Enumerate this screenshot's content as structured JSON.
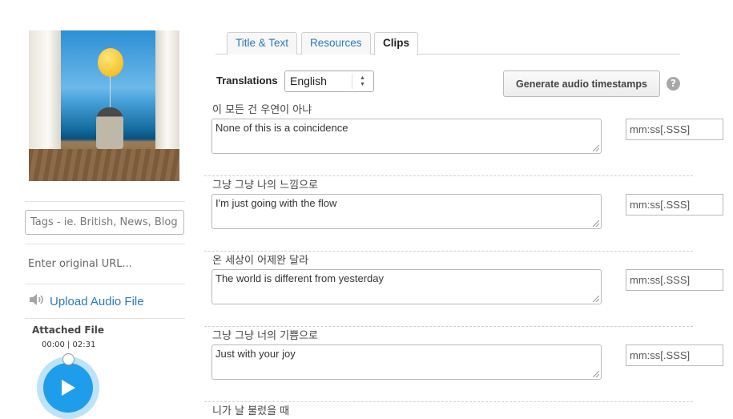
{
  "left": {
    "tags_placeholder": "Tags - ie. British, News, Blog",
    "url_placeholder": "Enter original URL...",
    "upload_label": "Upload Audio File",
    "attached_title": "Attached File",
    "time_display": "00:00 | 02:31"
  },
  "tabs": [
    {
      "label": "Title & Text",
      "active": false
    },
    {
      "label": "Resources",
      "active": false
    },
    {
      "label": "Clips",
      "active": true
    }
  ],
  "translations": {
    "label": "Translations",
    "selected": "English"
  },
  "generate_label": "Generate audio timestamps",
  "help_glyph": "?",
  "clips": [
    {
      "lyric": "이 모든 건 우연이 아냐",
      "translation": "None of this is a coincidence",
      "time_placeholder": "mm:ss[.SSS]"
    },
    {
      "lyric": "그냥 그냥 나의 느낌으로",
      "translation": "I'm just going with the flow",
      "time_placeholder": "mm:ss[.SSS]"
    },
    {
      "lyric": "온 세상이 어제완 달라",
      "translation": "The world is different from yesterday",
      "time_placeholder": "mm:ss[.SSS]"
    },
    {
      "lyric": "그냥 그냥 너의 기쁨으로",
      "translation": "Just with your joy",
      "time_placeholder": "mm:ss[.SSS]"
    },
    {
      "lyric": "니가 날 불렀을 때",
      "translation": "",
      "time_placeholder": ""
    }
  ],
  "colors": {
    "link": "#2a7ab8",
    "play": "#1e9eea"
  }
}
